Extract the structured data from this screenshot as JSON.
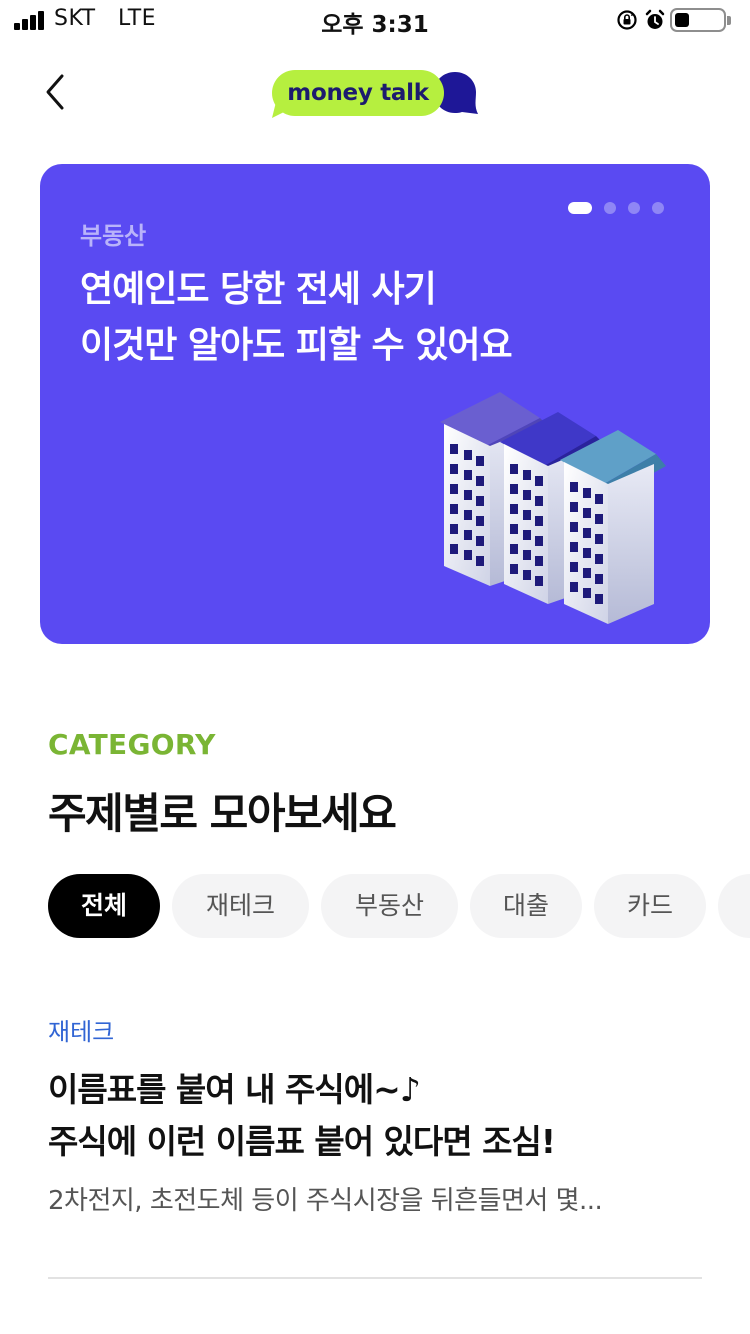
{
  "status_bar": {
    "carrier": "SKT",
    "network": "LTE",
    "time": "오후 3:31",
    "battery_level": 0.3
  },
  "header": {
    "back_icon": "chevron-left-icon",
    "logo_text": "money talk",
    "logo_colors": {
      "bubble": "#b6ef3f",
      "text": "#1c1b6e",
      "back_bubble": "#1e1797"
    }
  },
  "banner": {
    "category": "부동산",
    "title_line1": "연예인도 당한 전세 사기",
    "title_line2": "이것만 알아도 피할 수 있어요",
    "background": "#5a4af2",
    "page_count": 4,
    "active_page": 1
  },
  "category_section": {
    "eyebrow": "CATEGORY",
    "heading": "주제별로 모아보세요",
    "chips": [
      {
        "label": "전체",
        "active": true
      },
      {
        "label": "재테크",
        "active": false
      },
      {
        "label": "부동산",
        "active": false
      },
      {
        "label": "대출",
        "active": false
      },
      {
        "label": "카드",
        "active": false
      },
      {
        "label": "",
        "active": false
      }
    ]
  },
  "article": {
    "tag": "재테크",
    "title_line1": "이름표를 붙여 내 주식에~♪",
    "title_line2": "주식에 이런 이름표 붙어 있다면 조심!",
    "description": "2차전지, 초전도체 등이 주식시장을 뒤흔들면서 몇..."
  }
}
